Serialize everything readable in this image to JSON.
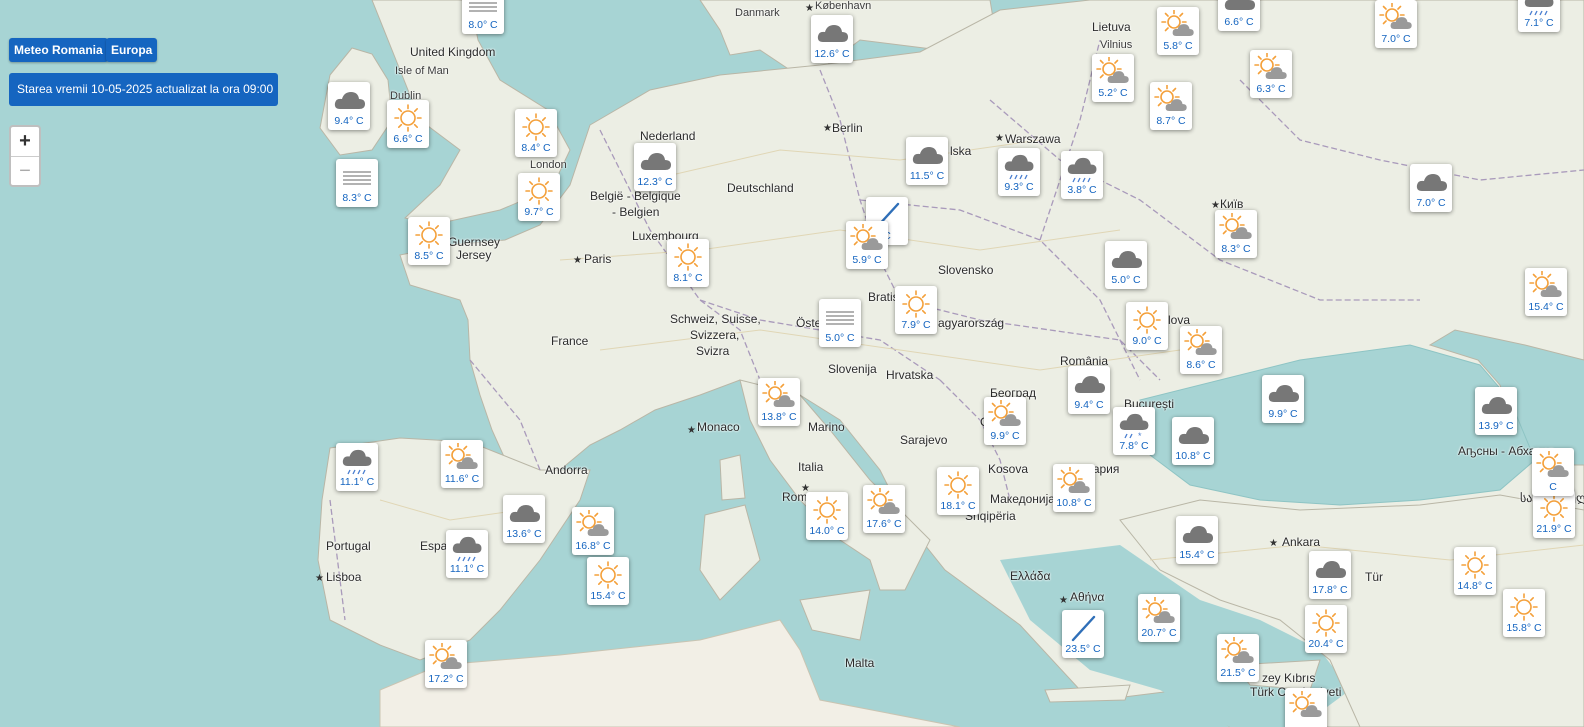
{
  "controls": {
    "meteo_button": "Meteo Romania",
    "europa_button": "Europa",
    "status_text": "Starea vremii 10-05-2025 actualizat la ora 09:00",
    "zoom_in": "+",
    "zoom_out": "−"
  },
  "map_labels": {
    "danmark": "Danmark",
    "kobenhavn": "København",
    "lietuva": "Lietuva",
    "vilnius": "Vilnius",
    "united_kingdom": "United Kingdom",
    "isle_of_man": "Isle of Man",
    "dublin": "Dublin",
    "nederland": "Nederland",
    "london": "London",
    "berlin": "Berlin",
    "warszawa": "Warszawa",
    "polska": "lska",
    "deutschland": "Deutschland",
    "belgie_1": "België - Belgique",
    "belgie_2": "- Belgien",
    "luxembourg": "Luxembourg",
    "guernsey": "Guernsey",
    "jersey": "Jersey",
    "paris": "Paris",
    "kyiv": "Київ",
    "slovensko": "Slovensko",
    "bratislava": "Bratisla",
    "magyarorszag": "agyarország",
    "moldova": "lova",
    "schweiz_1": "Schweiz, Suisse,",
    "schweiz_2": "Svizzera,",
    "schweiz_3": "Svizra",
    "osterreich": "Öste",
    "france": "France",
    "slovenija": "Slovenija",
    "hrvatska": "Hrvatska",
    "romania": "România",
    "beograd": "Београд",
    "bucuresti": "București",
    "srbija": "Cr",
    "monaco": "Monaco",
    "san_marino": "Marino",
    "sarajevo": "Sarajevo",
    "andorra": "Andorra",
    "italia": "Italia",
    "kosova": "Kosova",
    "bulgaria": "Бъ  гария",
    "abkhazia": "Аҧсны - Абхазия",
    "georgia": "საქართველო",
    "roma": "Roma",
    "makedonija": "Македонија",
    "shqiperia": "Shqipëria",
    "portugal": "Portugal",
    "espana": "Españ",
    "lisboa": "Lisboa",
    "ankara": "Ankara",
    "turkiye": "Tür",
    "ellada": "Ελλάδα",
    "athina": "Αθήνα",
    "malta": "Malta",
    "kibris_1": "zey Kıbrıs",
    "kibris_2": "Türk Cumhuriyeti"
  },
  "markers": [
    {
      "name": "marker-north-sea-top",
      "condition": "fog",
      "temp": "8.0° C"
    },
    {
      "name": "marker-kobenhavn",
      "condition": "cloudy",
      "temp": "12.6° C"
    },
    {
      "name": "marker-lietuva-north",
      "condition": "sun-cloud",
      "temp": "5.8° C"
    },
    {
      "name": "marker-latvia",
      "condition": "cloudy",
      "temp": "6.6° C"
    },
    {
      "name": "marker-moskva",
      "condition": "sun-cloud",
      "temp": "7.0° C"
    },
    {
      "name": "marker-russia-ne",
      "condition": "rain",
      "temp": "7.1° C"
    },
    {
      "name": "marker-vilnius",
      "condition": "sun-cloud",
      "temp": "5.2° C"
    },
    {
      "name": "marker-belarus-north",
      "condition": "sun-cloud",
      "temp": "6.3° C"
    },
    {
      "name": "marker-minsk",
      "condition": "sun-cloud",
      "temp": "8.7° C"
    },
    {
      "name": "marker-ireland-west",
      "condition": "cloudy",
      "temp": "9.4° C"
    },
    {
      "name": "marker-dublin",
      "condition": "sunny",
      "temp": "6.6° C"
    },
    {
      "name": "marker-uk-midlands",
      "condition": "sunny",
      "temp": "8.4° C"
    },
    {
      "name": "marker-amsterdam",
      "condition": "cloudy",
      "temp": "12.3° C"
    },
    {
      "name": "marker-polska-west",
      "condition": "cloudy",
      "temp": "11.5° C"
    },
    {
      "name": "marker-warszawa",
      "condition": "rain",
      "temp": "9.3° C"
    },
    {
      "name": "marker-belarus-south",
      "condition": "rain",
      "temp": "3.8° C"
    },
    {
      "name": "marker-russia-central",
      "condition": "cloudy",
      "temp": "7.0° C"
    },
    {
      "name": "marker-ireland-south",
      "condition": "fog",
      "temp": "8.3° C"
    },
    {
      "name": "marker-london",
      "condition": "sunny",
      "temp": "9.7° C"
    },
    {
      "name": "marker-praha",
      "condition": "wind",
      "temp": "C"
    },
    {
      "name": "marker-brittany",
      "condition": "sunny",
      "temp": "8.5° C"
    },
    {
      "name": "marker-czech",
      "condition": "sun-cloud",
      "temp": "5.9° C"
    },
    {
      "name": "marker-kyiv",
      "condition": "sun-cloud",
      "temp": "8.3° C"
    },
    {
      "name": "marker-luxembourg",
      "condition": "sunny",
      "temp": "8.1° C"
    },
    {
      "name": "marker-ukraine-west",
      "condition": "cloudy",
      "temp": "5.0° C"
    },
    {
      "name": "marker-russia-south",
      "condition": "sun-cloud",
      "temp": "15.4° C"
    },
    {
      "name": "marker-wien",
      "condition": "fog",
      "temp": "5.0° C"
    },
    {
      "name": "marker-budapest",
      "condition": "sunny",
      "temp": "7.9° C"
    },
    {
      "name": "marker-moldova",
      "condition": "sunny",
      "temp": "9.0° C"
    },
    {
      "name": "marker-odessa",
      "condition": "sun-cloud",
      "temp": "8.6° C"
    },
    {
      "name": "marker-romania",
      "condition": "cloudy",
      "temp": "9.4° C"
    },
    {
      "name": "marker-black-sea",
      "condition": "cloudy",
      "temp": "9.9° C"
    },
    {
      "name": "marker-krasnodar",
      "condition": "cloudy",
      "temp": "13.9° C"
    },
    {
      "name": "marker-venezia",
      "condition": "sun-cloud",
      "temp": "13.8° C"
    },
    {
      "name": "marker-beograd",
      "condition": "sun-cloud",
      "temp": "9.9° C"
    },
    {
      "name": "marker-bucuresti",
      "condition": "rain-snow",
      "temp": "7.8° C"
    },
    {
      "name": "marker-constanta",
      "condition": "cloudy",
      "temp": "10.8° C"
    },
    {
      "name": "marker-galicia",
      "condition": "rain",
      "temp": "11.1° C"
    },
    {
      "name": "marker-burgos",
      "condition": "sun-cloud",
      "temp": "11.6° C"
    },
    {
      "name": "marker-barcelona",
      "condition": "cloudy",
      "temp": "13.6° C"
    },
    {
      "name": "marker-sardinia-north",
      "condition": "sun-cloud",
      "temp": "16.8° C"
    },
    {
      "name": "marker-madrid",
      "condition": "rain",
      "temp": "11.1° C"
    },
    {
      "name": "marker-sardinia",
      "condition": "sunny",
      "temp": "15.4° C"
    },
    {
      "name": "marker-roma",
      "condition": "sunny",
      "temp": "14.0° C"
    },
    {
      "name": "marker-bari",
      "condition": "sun-cloud",
      "temp": "17.6° C"
    },
    {
      "name": "marker-albania",
      "condition": "sunny",
      "temp": "18.1° C"
    },
    {
      "name": "marker-sofia",
      "condition": "sun-cloud",
      "temp": "10.8° C"
    },
    {
      "name": "marker-istanbul",
      "condition": "cloudy",
      "temp": "15.4° C"
    },
    {
      "name": "marker-georgia",
      "condition": "sunny",
      "temp": "21.9° C"
    },
    {
      "name": "marker-caucasus",
      "condition": "sun-cloud",
      "temp": "C"
    },
    {
      "name": "marker-turkey-central",
      "condition": "cloudy",
      "temp": "17.8° C"
    },
    {
      "name": "marker-turkey-east",
      "condition": "sunny",
      "temp": "14.8° C"
    },
    {
      "name": "marker-turkey-se",
      "condition": "sunny",
      "temp": "15.8° C"
    },
    {
      "name": "marker-andalucia",
      "condition": "sun-cloud",
      "temp": "17.2° C"
    },
    {
      "name": "marker-athina",
      "condition": "wind",
      "temp": "23.5° C"
    },
    {
      "name": "marker-izmir",
      "condition": "sun-cloud",
      "temp": "20.7° C"
    },
    {
      "name": "marker-antalya",
      "condition": "sunny",
      "temp": "20.4° C"
    },
    {
      "name": "marker-cyprus",
      "condition": "sun-cloud",
      "temp": "21.5° C"
    },
    {
      "name": "marker-cyprus-south",
      "condition": "sun-cloud",
      "temp": ""
    }
  ]
}
